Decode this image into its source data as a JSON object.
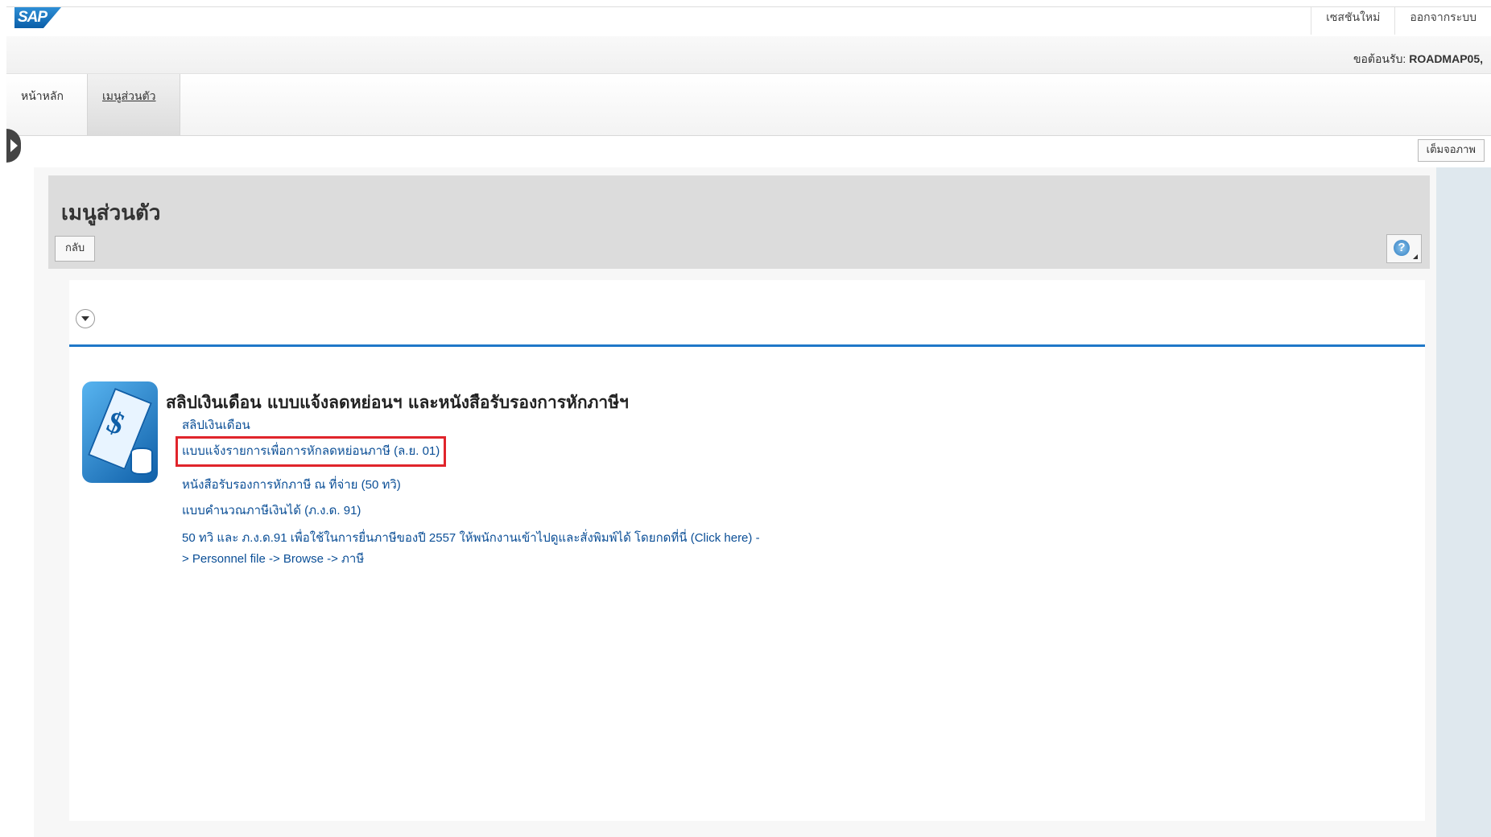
{
  "header": {
    "logo_text": "SAP",
    "links": [
      "เซสชันใหม่",
      "ออกจากระบบ"
    ],
    "welcome_label": "ขอต้อนรับ:",
    "welcome_user": "ROADMAP05,"
  },
  "tabs": [
    {
      "label": "หน้าหลัก"
    },
    {
      "label": "เมนูส่วนตัว"
    }
  ],
  "toolbar": {
    "fullscreen_label": "เต็มจอภาพ"
  },
  "page": {
    "title": "เมนูส่วนตัว",
    "back_label": "กลับ",
    "help_glyph": "?"
  },
  "group": {
    "title": "สลิปเงินเดือน แบบแจ้งลดหย่อนฯ และหนังสือรับรองการหักภาษีฯ",
    "icon": "payslip-dollar-icon",
    "links": [
      {
        "label": "สลิปเงินเดือน"
      },
      {
        "label": "แบบแจ้งรายการเพื่อการหักลดหย่อนภาษี (ล.ย. 01)"
      },
      {
        "label": "หนังสือรับรองการหักภาษี ณ ที่จ่าย (50 ทวิ)"
      },
      {
        "label": "แบบคำนวณภาษีเงินได้ (ภ.ง.ด. 91)"
      },
      {
        "label": "50 ทวิ และ ภ.ง.ด.91 เพื่อใช้ในการยื่นภาษีของปี 2557 ให้พนักงานเข้าไปดูและสั่งพิมพ์ได้ โดยกดที่นี่ (Click here) -> Personnel file -> Browse -> ภาษี"
      }
    ],
    "highlight_color": "#e0242b"
  }
}
